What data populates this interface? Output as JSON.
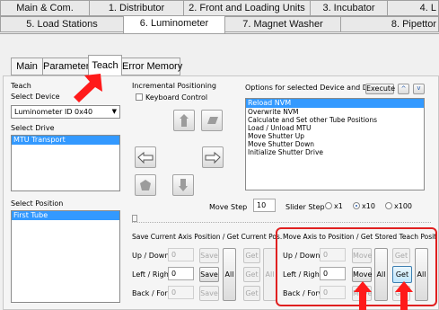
{
  "tabs_row1": [
    "Main & Com.",
    "1. Distributor",
    "2. Front and Loading Units",
    "3. Incubator",
    "4. L"
  ],
  "tabs_row2": [
    "5. Load Stations",
    "6. Luminometer",
    "7. Magnet Washer",
    "8. Pipettor"
  ],
  "subtabs": [
    "Main",
    "Parameter",
    "Teach",
    "Error Memory"
  ],
  "teach": {
    "group_label": "Teach",
    "select_device_label": "Select Device",
    "device_value": "Luminometer ID 0x40",
    "select_drive_label": "Select Drive",
    "drives": [
      "MTU Transport"
    ],
    "select_position_label": "Select Position",
    "positions": [
      "First Tube"
    ]
  },
  "incremental": {
    "label": "Incremental Positioning",
    "keyboard_control": "Keyboard Control",
    "move_step_label": "Move Step",
    "move_step_value": "10",
    "slider_step_label": "Slider Step",
    "slider_options": [
      "x1",
      "x10",
      "x100"
    ],
    "slider_selected": "x10"
  },
  "options": {
    "label": "Options for selected Device and Drive",
    "execute": "Execute",
    "up": "^",
    "down": "v",
    "items": [
      "Reload NVM",
      "Overwrite NVM",
      "Calculate and Set other Tube Positions",
      "Load / Unload MTU",
      "Move Shutter Up",
      "Move Shutter Down",
      "Initialize Shutter Drive"
    ]
  },
  "save_group": {
    "label": "Save Current Axis Position / Get Current Pos.",
    "rows": [
      {
        "label": "Up / Down",
        "value": "0"
      },
      {
        "label": "Left / Right",
        "value": "0"
      },
      {
        "label": "Back / Forw.",
        "value": "0"
      }
    ],
    "save": "Save",
    "all": "All",
    "get": "Get"
  },
  "move_group": {
    "label": "Move Axis to Position / Get Stored Teach Position",
    "rows": [
      {
        "label": "Up / Down",
        "value": "0"
      },
      {
        "label": "Left / Right",
        "value": "0"
      },
      {
        "label": "Back / Forw.",
        "value": "0"
      }
    ],
    "move": "Move",
    "all": "All",
    "get": "Get"
  },
  "colors": {
    "highlight": "#3399ff",
    "arrow": "#ff1a1a",
    "annotation": "#e02020"
  }
}
